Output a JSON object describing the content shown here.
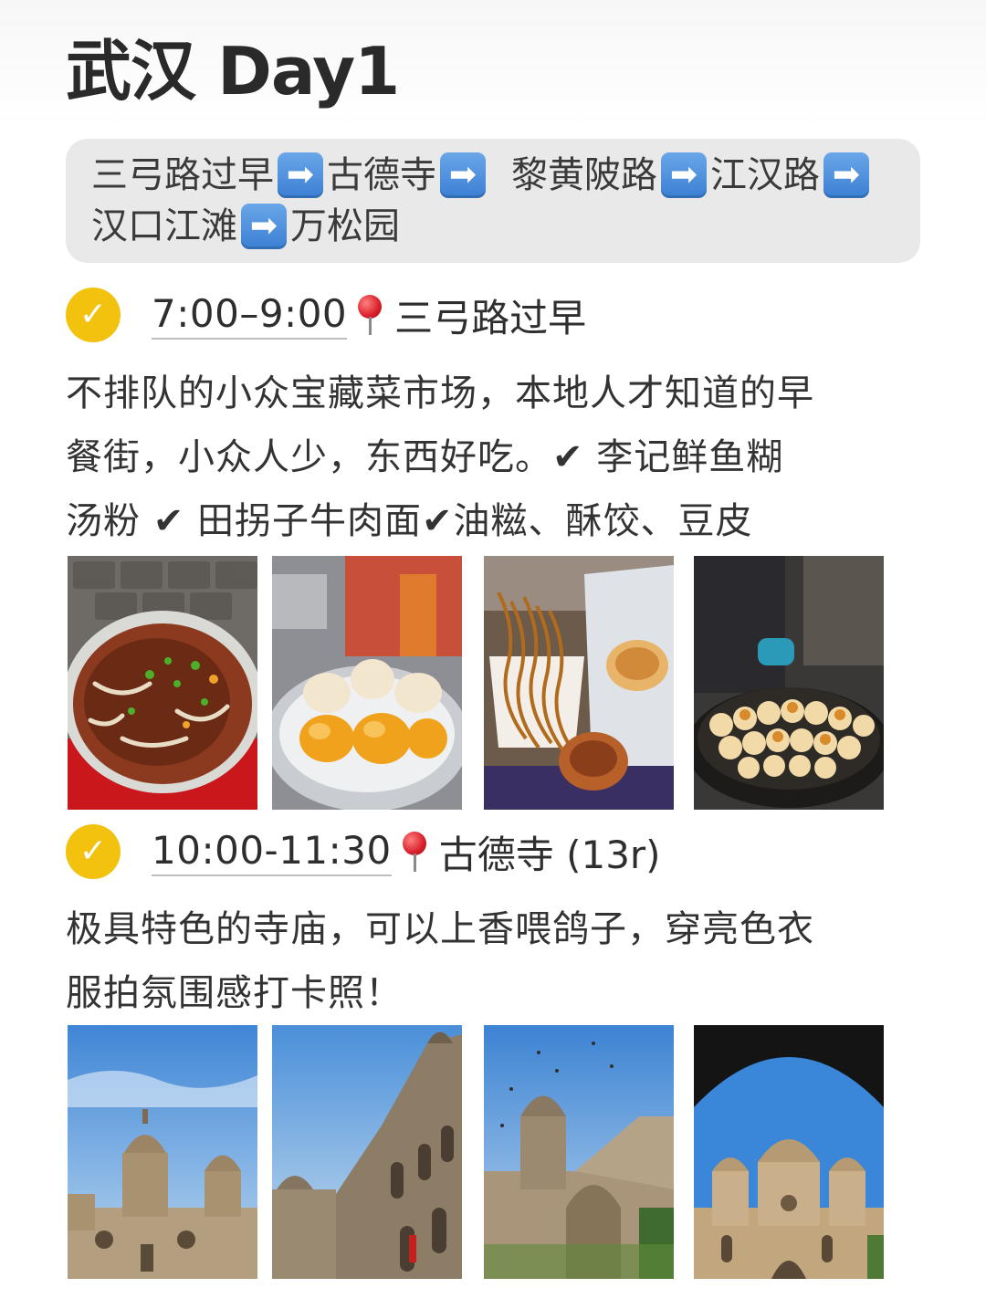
{
  "title": "武汉 Day1",
  "route": {
    "line1": [
      "三弓路过早",
      "古德寺",
      "黎黄陂路",
      "江汉路"
    ],
    "line2": [
      "汉口江滩",
      "万松园"
    ],
    "arrow_glyph": "➡"
  },
  "sections": [
    {
      "check_glyph": "✓",
      "time": "7:00–9:00",
      "place": "三弓路过早",
      "desc_lines": [
        "不排队的小众宝藏菜市场，本地人才知道的早",
        "餐街，小众人少，东西好吃。✔ 李记鲜鱼糊",
        "汤粉 ✔ 田拐子牛肉面✔油糍、酥饺、豆皮"
      ],
      "photos": [
        "beef-noodle-photo",
        "fried-dumplings-photo",
        "noodles-and-doupi-photo",
        "pan-fried-buns-photo"
      ]
    },
    {
      "check_glyph": "✓",
      "time": "10:00-11:30",
      "place": "古德寺 (13r)",
      "desc_lines": [
        "极具特色的寺庙，可以上香喂鸽子，穿亮色衣",
        "服拍氛围感打卡照！"
      ],
      "photos": [
        "temple-photo-1",
        "temple-photo-2",
        "temple-photo-3",
        "temple-photo-4"
      ]
    }
  ],
  "colors": {
    "check_yellow": "#f2c20e",
    "arrow_blue": "#3b7fd4",
    "route_bg": "#e9e9e9",
    "pin_red": "#d81e2a"
  }
}
